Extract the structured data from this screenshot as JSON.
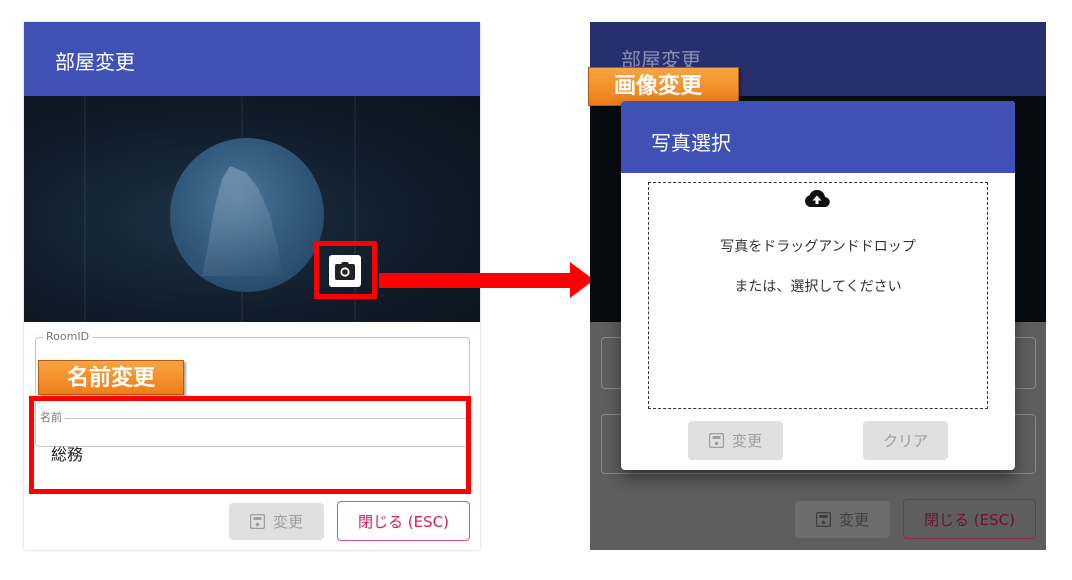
{
  "left": {
    "title": "部屋変更",
    "room_id_label": "RoomID",
    "rename_annotation": "名前変更",
    "name_label": "名前",
    "name_value": "総務",
    "save_label": "変更",
    "close_label": "閉じる (ESC)"
  },
  "right": {
    "title": "部屋変更",
    "image_annotation": "画像変更",
    "save_label": "変更",
    "close_label": "閉じる (ESC)",
    "photo_dialog": {
      "title": "写真選択",
      "drop_line1": "写真をドラッグアンドドロップ",
      "drop_line2": "または、選択してください",
      "save_label": "変更",
      "clear_label": "クリア"
    }
  },
  "colors": {
    "header": "#3f51b5",
    "highlight": "#ff0000",
    "badge": "#f08a24",
    "close_accent": "#d81b60"
  },
  "icons": [
    "camera-icon",
    "save-icon",
    "cloud-upload-icon"
  ]
}
